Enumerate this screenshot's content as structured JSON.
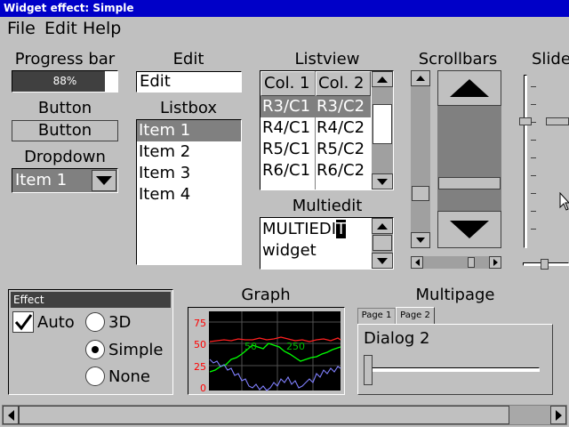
{
  "window": {
    "title": "Widget effect: Simple"
  },
  "menu": {
    "items": [
      "File",
      "Edit",
      "Help"
    ]
  },
  "progress": {
    "label": "Progress bar",
    "value_text": "88%",
    "fraction": 0.88
  },
  "button": {
    "label": "Button",
    "text": "Button"
  },
  "dropdown": {
    "label": "Dropdown",
    "selected": "Item 1"
  },
  "edit": {
    "label": "Edit",
    "value": "Edit"
  },
  "listbox": {
    "label": "Listbox",
    "items": [
      "Item 1",
      "Item 2",
      "Item 3",
      "Item 4"
    ],
    "selected_index": 0
  },
  "listview": {
    "label": "Listview",
    "columns": [
      "Col. 1",
      "Col. 2"
    ],
    "rows": [
      [
        "R3/C1",
        "R3/C2"
      ],
      [
        "R4/C1",
        "R4/C2"
      ],
      [
        "R5/C1",
        "R5/C2"
      ],
      [
        "R6/C1",
        "R6/C2"
      ]
    ]
  },
  "multiedit": {
    "label": "Multiedit",
    "line1_text": "MULTIEDI",
    "line1_cursor_char": "T",
    "line2": "widget"
  },
  "scrollbars": {
    "label": "Scrollbars"
  },
  "slider": {
    "label": "Slide"
  },
  "effect": {
    "frame_title": "Effect",
    "auto_label": "Auto",
    "auto_checked": true,
    "options": [
      "3D",
      "Simple",
      "None"
    ],
    "selected": "Simple"
  },
  "graph": {
    "label": "Graph",
    "y_ticks": [
      "75",
      "50",
      "25",
      "0"
    ],
    "annotations": [
      "50",
      "250"
    ]
  },
  "multipage": {
    "label": "Multipage",
    "tabs": [
      "Page 1",
      "Page 2"
    ],
    "active_tab": "Page 2",
    "dialog_title": "Dialog 2"
  },
  "colors": {
    "title_bar": "#0000c8",
    "selection": "#808080",
    "graph_red": "#ff2020",
    "graph_green": "#00ff00",
    "graph_blue": "#8080ff",
    "graph_axis_labels": "#ff0000"
  }
}
